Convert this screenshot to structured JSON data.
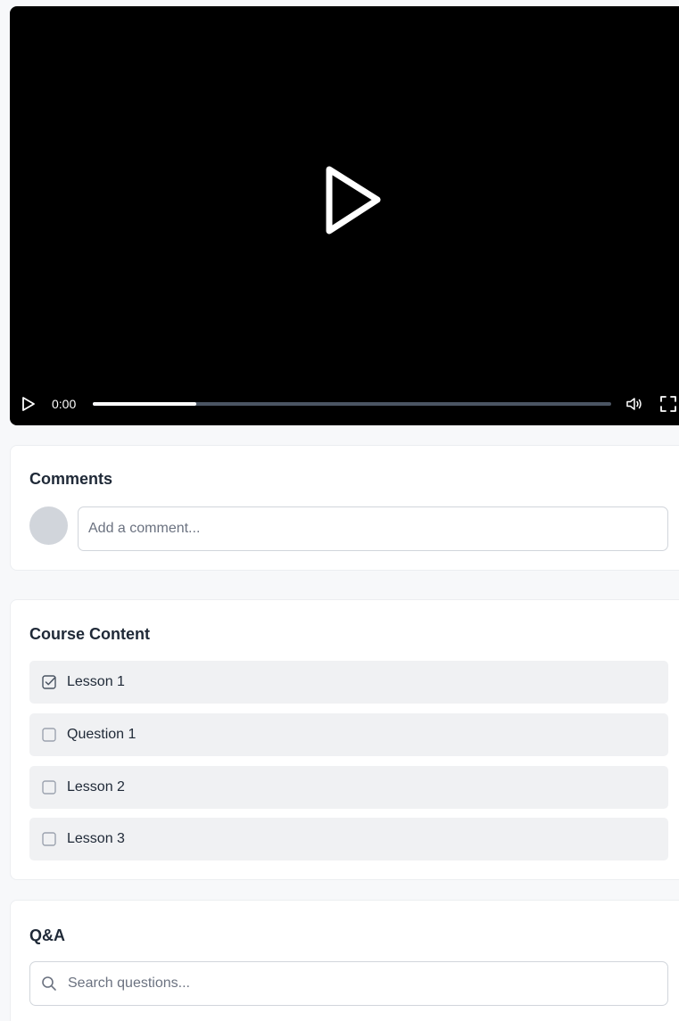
{
  "video": {
    "current_time": "0:00",
    "progress": 0.2,
    "play_icon": "play-icon",
    "volume_icon": "volume-icon",
    "fullscreen_icon": "fullscreen-icon"
  },
  "comments": {
    "title": "Comments",
    "input_placeholder": "Add a comment..."
  },
  "course_content": {
    "title": "Course Content",
    "items": [
      {
        "label": "Lesson 1",
        "checked": true
      },
      {
        "label": "Question 1",
        "checked": false
      },
      {
        "label": "Lesson 2",
        "checked": false
      },
      {
        "label": "Lesson 3",
        "checked": false
      }
    ]
  },
  "qa": {
    "title": "Q&A",
    "search_placeholder": "Search questions..."
  },
  "colors": {
    "video_bg": "#000000",
    "progress_fill": "#ffffff",
    "progress_track": "#4b5563",
    "item_bg": "#f0f1f3",
    "avatar": "#d1d5db"
  }
}
